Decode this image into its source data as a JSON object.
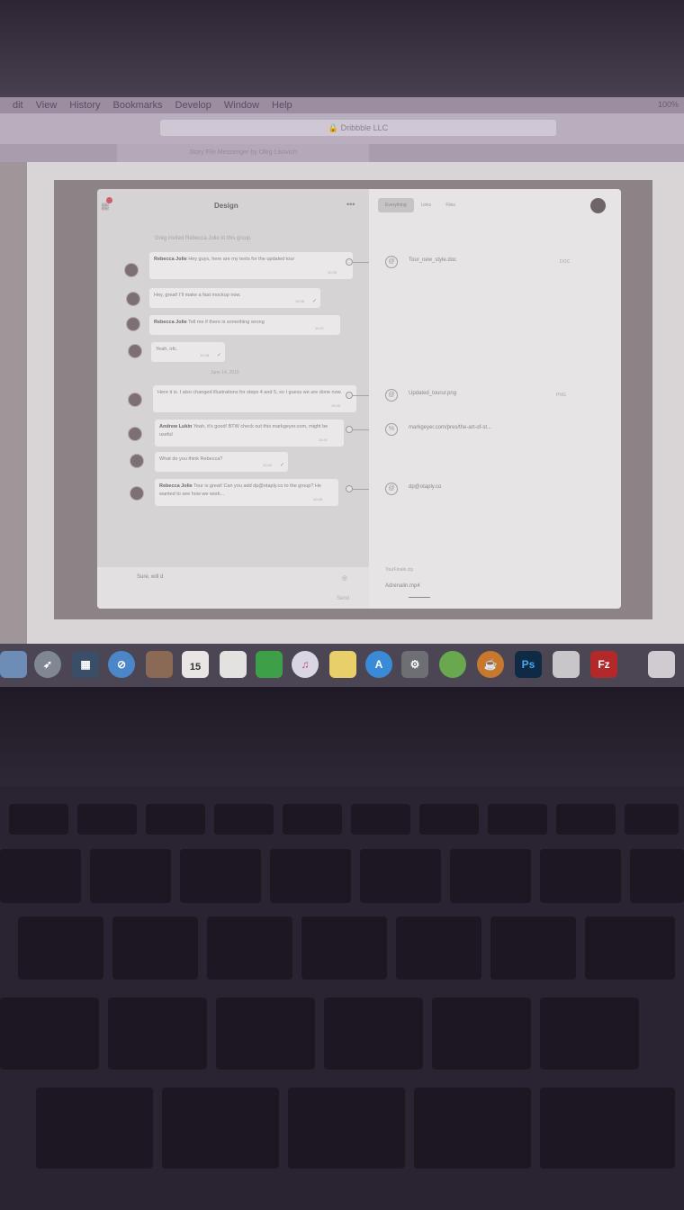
{
  "menubar": {
    "items": [
      "dit",
      "View",
      "History",
      "Bookmarks",
      "Develop",
      "Window",
      "Help"
    ],
    "status": "100%"
  },
  "browser": {
    "url": "Dribbble LLC",
    "tab_title": "Story File Messenger by Oleg Lisovich"
  },
  "app": {
    "chat_title": "Design",
    "system_message": "Greg invited Rebecca Jolie to this group",
    "date_separator": "June 14, 2015",
    "messages": [
      {
        "author": "Rebecca Jolie",
        "text": "Hey guys, here are my texts for the updated tour",
        "time": "10:35",
        "check": ""
      },
      {
        "author": "",
        "text": "Hey, great! I'll make a fast mockup now.",
        "time": "10:36",
        "check": "✓"
      },
      {
        "author": "Rebecca Jolie",
        "text": "Tell me if there is something wrong",
        "time": "10:37",
        "check": ""
      },
      {
        "author": "",
        "text": "Yeah, ofc.",
        "time": "10:38",
        "check": "✓"
      },
      {
        "author": "",
        "text": "Here it is. I also changed illustrations for steps 4 and 5, so I guess we are done now.",
        "time": "10:40",
        "check": ""
      },
      {
        "author": "Andrew Lukin",
        "text": "Yeah, it's good! BTW check out this markgeyer.com, might be useful",
        "time": "10:41",
        "check": ""
      },
      {
        "author": "",
        "text": "What do you think Rebecca?",
        "time": "10:42",
        "check": "✓"
      },
      {
        "author": "Rebecca Jolie",
        "text": "Tour is great! Can you add dp@otaply.co to the group? He wanted to see how we work...",
        "time": "10:45",
        "check": ""
      }
    ],
    "composer_text": "Sure, will d",
    "send_label": "Send",
    "side_tabs": [
      "Everything",
      "Links",
      "Files"
    ],
    "files": [
      {
        "name": "Tour_new_style.doc",
        "type": "DOC",
        "icon": "paperclip-icon"
      },
      {
        "name": "Updated_tourur.png",
        "type": "PNG",
        "icon": "paperclip-icon"
      },
      {
        "name": "markgeyer.com/pres/the-art-of-st...",
        "type": "",
        "icon": "link-icon"
      },
      {
        "name": "dp@otaply.co",
        "type": "",
        "icon": "at-icon"
      }
    ],
    "uploading_label": "TourFinale.zip",
    "uploading_file": "Adrenalin.mp4"
  },
  "dock": {
    "calendar_day": "15",
    "ps_label": "Ps",
    "fz_label": "Fz"
  },
  "colors": {
    "notification": "#c9606c",
    "chat_bg": "#d6d3d4",
    "side_bg": "#e6e4e4"
  }
}
